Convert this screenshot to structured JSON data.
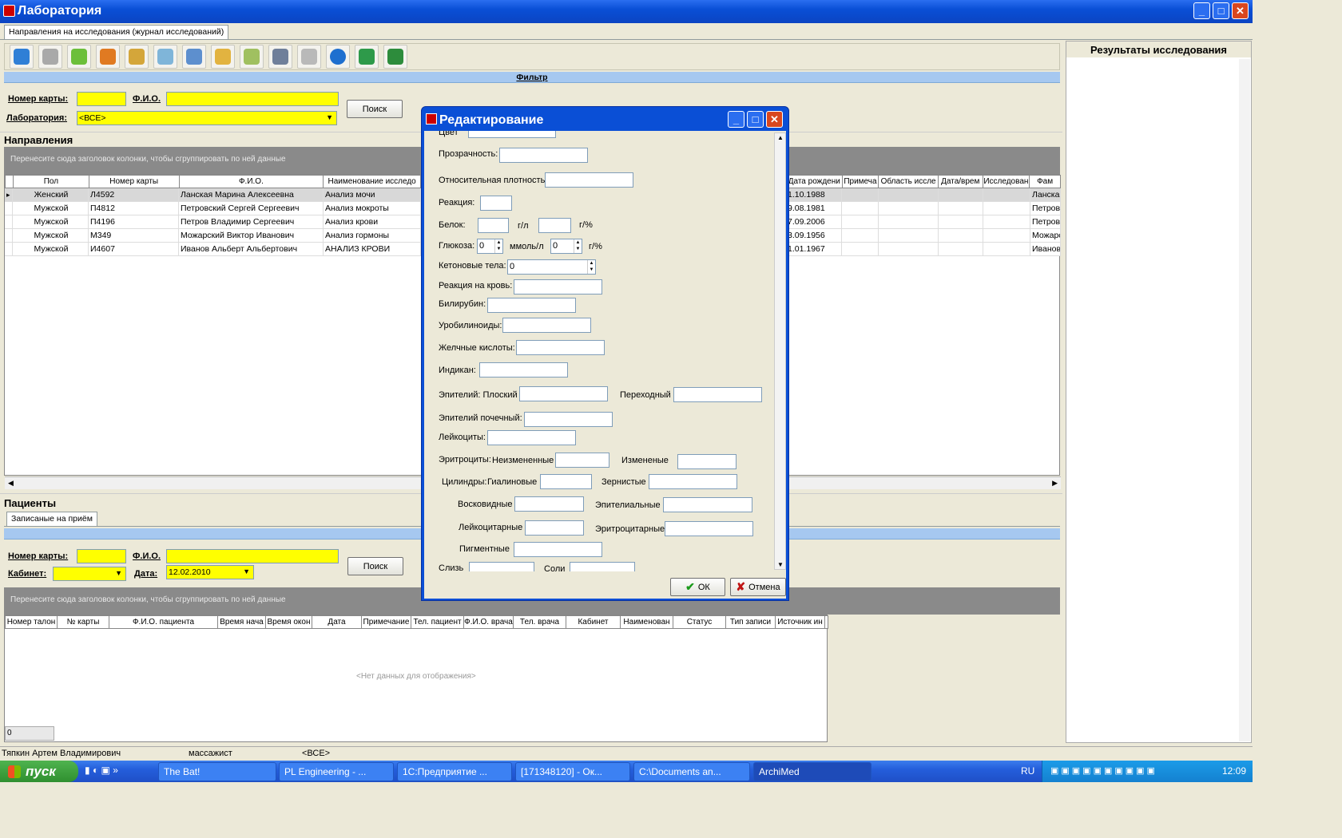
{
  "app": {
    "title": "Лаборатория"
  },
  "tab_main": "Направления на исследования (журнал исследований)",
  "results_title": "Результаты исследования",
  "filter": {
    "title": "Фильтр",
    "card_label": "Номер карты:",
    "fio_label": "Ф.И.О.",
    "lab_label": "Лаборатория:",
    "lab_value": "<ВСЕ>",
    "search": "Поиск"
  },
  "directions": {
    "title": "Направления",
    "group_hint": "Перенесите сюда заголовок колонки, чтобы сгруппировать по ней данные",
    "columns": [
      "Пол",
      "Номер карты",
      "Ф.И.О.",
      "Наименование исследо"
    ],
    "right_columns": [
      "Дата рождени",
      "Примеча",
      "Область иссле",
      "Дата/врем",
      "Исследован",
      "Фам"
    ],
    "rows": [
      {
        "sex": "Женский",
        "card": "Л4592",
        "fio": "Ланская Марина Алексеевна",
        "name": "Анализ мочи",
        "dob": "1.10.1988",
        "fam": "Ланска"
      },
      {
        "sex": "Мужской",
        "card": "П4812",
        "fio": "Петровский Сергей Сергеевич",
        "name": "Анализ мокроты",
        "dob": "9.08.1981",
        "fam": "Петров"
      },
      {
        "sex": "Мужской",
        "card": "П4196",
        "fio": "Петров Владимир Сергеевич",
        "name": "Анализ крови",
        "dob": "7.09.2006",
        "fam": "Петров"
      },
      {
        "sex": "Мужской",
        "card": "М349",
        "fio": "Можарский Виктор Иванович",
        "name": "Анализ гормоны",
        "dob": "3.09.1956",
        "fam": "Можарс"
      },
      {
        "sex": "Мужской",
        "card": "И4607",
        "fio": "Иванов Альберт Альбертович",
        "name": "АНАЛИЗ КРОВИ",
        "dob": "1.01.1967",
        "fam": "Иванов"
      }
    ]
  },
  "patients": {
    "title": "Пациенты",
    "tab": "Записаные на приём",
    "card_label": "Номер карты:",
    "fio_label": "Ф.И.О.",
    "cabinet_label": "Кабинет:",
    "date_label": "Дата:",
    "date_value": "12.02.2010",
    "search": "Поиск",
    "group_hint": "Перенесите сюда заголовок колонки, чтобы сгруппировать по ней данные",
    "columns": [
      "Номер талон",
      "№ карты",
      "Ф.И.О. пациента",
      "Время нача",
      "Время окон",
      "Дата",
      "Примечание",
      "Тел. пациент",
      "Ф.И.О. врача",
      "Тел. врача",
      "Кабинет",
      "Наименован",
      "Статус",
      "Тип записи",
      "Источник ин"
    ],
    "empty": "<Нет данных для отображения>",
    "count": "0"
  },
  "status": {
    "user": "Тяпкин  Артем Владимирович",
    "role": "массажист",
    "filter": "<ВСЕ>"
  },
  "dialog": {
    "title": "Редактирование",
    "f_color": "Цвет",
    "f_transparency": "Прозрачность:",
    "f_density": "Относительная плотность:",
    "f_reaction": "Реакция:",
    "f_protein": "Белок:",
    "u_gl": "г/л",
    "u_gpct": "г/%",
    "f_glucose": "Глюкоза:",
    "glucose_val": "0",
    "u_mmol": "ммоль/л",
    "glucose_val2": "0",
    "f_ketone": "Кетоновые тела:",
    "ketone_val": "0",
    "f_blood": "Реакция на кровь:",
    "f_bilirubin": "Билирубин:",
    "f_urobil": "Уробилиноиды:",
    "f_bile": "Желчные кислоты:",
    "f_indican": "Индикан:",
    "f_epi_flat": "Эпителий: Плоский",
    "f_epi_trans": "Переходный",
    "f_epi_renal": "Эпителий почечный:",
    "f_leuko": "Лейкоциты:",
    "f_ery": "Эритроциты:",
    "f_ery_unch": "Неизмененные",
    "f_ery_ch": "Измененые",
    "f_cyl": "Цилиндры:",
    "f_hyal": "Гиалиновые",
    "f_gran": "Зернистые",
    "f_wax": "Восковидные",
    "f_epith": "Эпителиальные",
    "f_leucyl": "Лейкоцитарные",
    "f_erycyl": "Эритроцитарные",
    "f_pigm": "Пигментные",
    "f_mucus": "Слизь",
    "f_salts": "Соли",
    "ok": "ОК",
    "cancel": "Отмена"
  },
  "toolbar": {
    "icons": [
      "refresh-icon",
      "filter-icon",
      "coins-icon",
      "shapes-icon",
      "grid-check-icon",
      "pen-icon",
      "paperclip-icon",
      "stamp-icon",
      "notepad-icon",
      "calculator-icon",
      "printer-icon",
      "arrow-icon",
      "chart-icon",
      "excel-icon"
    ]
  },
  "taskbar": {
    "start": "пуск",
    "items": [
      "The Bat!",
      "PL Engineering - ...",
      "1С:Предприятие ...",
      "[171348120] - Ок...",
      "C:\\Documents an...",
      "ArchiMed"
    ],
    "lang": "RU",
    "clock": "12:09"
  },
  "colors": {
    "title_bar": "#0a4fd6",
    "input_yellow": "#ffff00",
    "header_bar": "#a6c8f0"
  }
}
